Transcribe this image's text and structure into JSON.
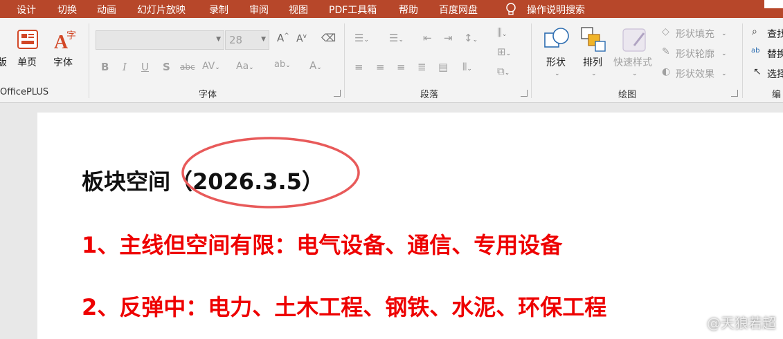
{
  "tabs": [
    "设计",
    "切换",
    "动画",
    "幻灯片放映",
    "录制",
    "审阅",
    "视图",
    "PDF工具箱",
    "帮助",
    "百度网盘",
    "操作说明搜索"
  ],
  "ribbon": {
    "left_cut": "版",
    "single_page": "单页",
    "font_btn": "字体",
    "officeplus": "OfficePLUS",
    "font_size": "28",
    "group_font": "字体",
    "group_paragraph": "段落",
    "group_drawing": "绘图",
    "group_edit_cut": "编",
    "shape": "形状",
    "arrange": "排列",
    "quick_style": "快速样式",
    "shape_fill": "形状填充",
    "shape_outline": "形状轮廓",
    "shape_effect": "形状效果",
    "find": "查找",
    "replace": "替换",
    "select": "选择"
  },
  "slide": {
    "title": "板块空间（2026.3.5）",
    "line1": "1、主线但空间有限：电气设备、通信、专用设备",
    "line2": "2、反弹中：电力、土木工程、钢铁、水泥、环保工程"
  },
  "watermark": "@天狼若超",
  "colors": {
    "tabbar": "#b7472a",
    "accent_red": "#ee0000",
    "circle": "#e85a5a"
  }
}
